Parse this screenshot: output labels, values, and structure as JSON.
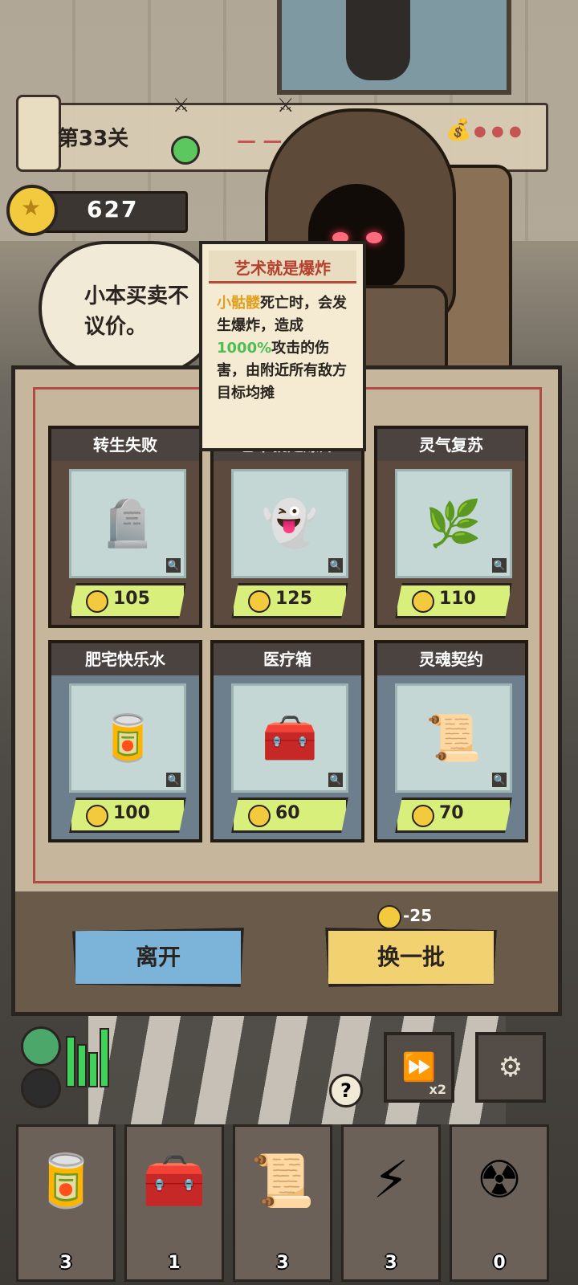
{
  "stage": {
    "label": "第33关"
  },
  "gold": {
    "amount": "627"
  },
  "merchant": {
    "speech": "小本买卖不议价。"
  },
  "tooltip": {
    "title": "艺术就是爆炸",
    "desc_part1": "小骷髅",
    "desc_part2": "死亡时，会发生爆炸，造成",
    "desc_part3": "1000%",
    "desc_part4": "攻击的伤害，由附近所有敌方目标均摊"
  },
  "shop": {
    "items": [
      {
        "name": "转生失败",
        "price": "105",
        "icon": "tombstone-icon",
        "glyph": "🪦",
        "frame": "brown"
      },
      {
        "name": "艺术就是爆炸",
        "price": "125",
        "icon": "ghost-bomb-icon",
        "glyph": "👻",
        "frame": "brown"
      },
      {
        "name": "灵气复苏",
        "price": "110",
        "icon": "spirit-hat-icon",
        "glyph": "🌿",
        "frame": "brown"
      },
      {
        "name": "肥宅快乐水",
        "price": "100",
        "icon": "cola-can-icon",
        "glyph": "🥫",
        "frame": "blue"
      },
      {
        "name": "医疗箱",
        "price": "60",
        "icon": "medkit-icon",
        "glyph": "🧰",
        "frame": "blue"
      },
      {
        "name": "灵魂契约",
        "price": "70",
        "icon": "contract-scroll-icon",
        "glyph": "📜",
        "frame": "blue"
      }
    ],
    "leave_label": "离开",
    "refresh_label": "换一批",
    "refresh_cost": "-25"
  },
  "hud": {
    "speed_label": "x2",
    "help_label": "?"
  },
  "inventory": [
    {
      "icon": "cola-can-icon",
      "glyph": "🥫",
      "count": "3"
    },
    {
      "icon": "medkit-icon",
      "glyph": "🧰",
      "count": "1"
    },
    {
      "icon": "contract-scroll-icon",
      "glyph": "📜",
      "count": "3"
    },
    {
      "icon": "lightning-card-icon",
      "glyph": "⚡",
      "count": "3"
    },
    {
      "icon": "radiation-bomb-icon",
      "glyph": "☢",
      "count": "0"
    }
  ],
  "colors": {
    "price_bg": "#d9ef7c",
    "leave_btn": "#7cb3d9",
    "refresh_btn": "#f2d171",
    "tooltip_title": "#b5402e"
  }
}
